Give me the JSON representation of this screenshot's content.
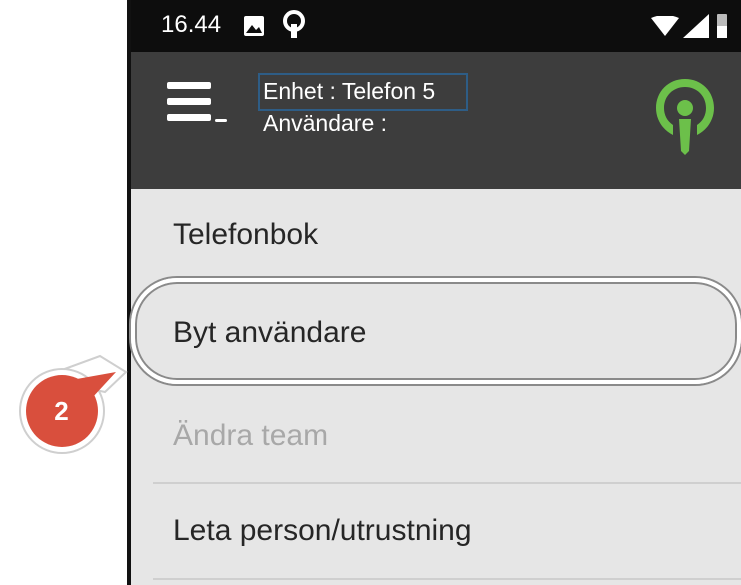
{
  "status_bar": {
    "time": "16.44",
    "icons": [
      "image-icon",
      "notification-icon",
      "wifi-icon",
      "signal-icon",
      "battery-icon"
    ]
  },
  "app_bar": {
    "device_label": "Enhet : Telefon 5",
    "user_label": "Användare :",
    "menu_icon": "menu-icon",
    "logo_icon": "app-logo-icon",
    "logo_color": "#6cc04a",
    "background": "#3d3d3d"
  },
  "menu": {
    "items": [
      {
        "label": "Telefonbok",
        "enabled": true
      },
      {
        "label": "Byt användare",
        "enabled": true,
        "highlighted": true
      },
      {
        "label": "Ändra team",
        "enabled": false
      },
      {
        "label": "Leta person/utrustning",
        "enabled": true
      }
    ]
  },
  "callout": {
    "step_number": "2",
    "color": "#d94f3d"
  }
}
